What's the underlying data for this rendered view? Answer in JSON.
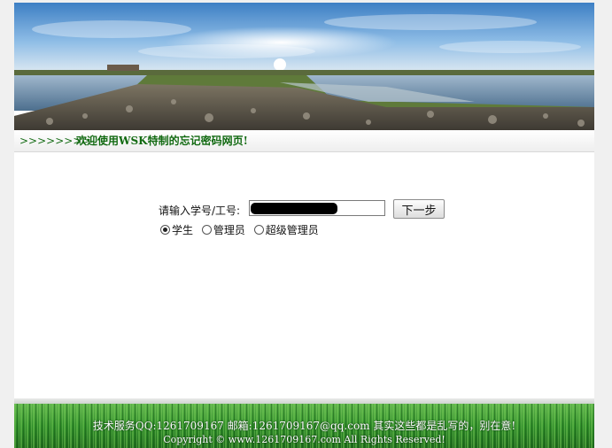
{
  "welcome": {
    "arrows": ">>>>>>>>",
    "message": "欢迎使用WSK特制的忘记密码网页!"
  },
  "form": {
    "id_label": "请输入学号/工号:",
    "id_value": "",
    "next_label": "下一步",
    "roles": [
      {
        "label": "学生",
        "selected": true
      },
      {
        "label": "管理员",
        "selected": false
      },
      {
        "label": "超级管理员",
        "selected": false
      }
    ]
  },
  "footer": {
    "line1": "技术服务QQ:1261709167 邮箱:1261709167@qq.com 其实这些都是乱写的，别在意!",
    "line2": "Copyright © www.1261709167.com All Rights Reserved!"
  },
  "colors": {
    "welcome_text": "#126a12",
    "footer_grass": "#2f8f2a",
    "background": "#f0f0f0"
  }
}
